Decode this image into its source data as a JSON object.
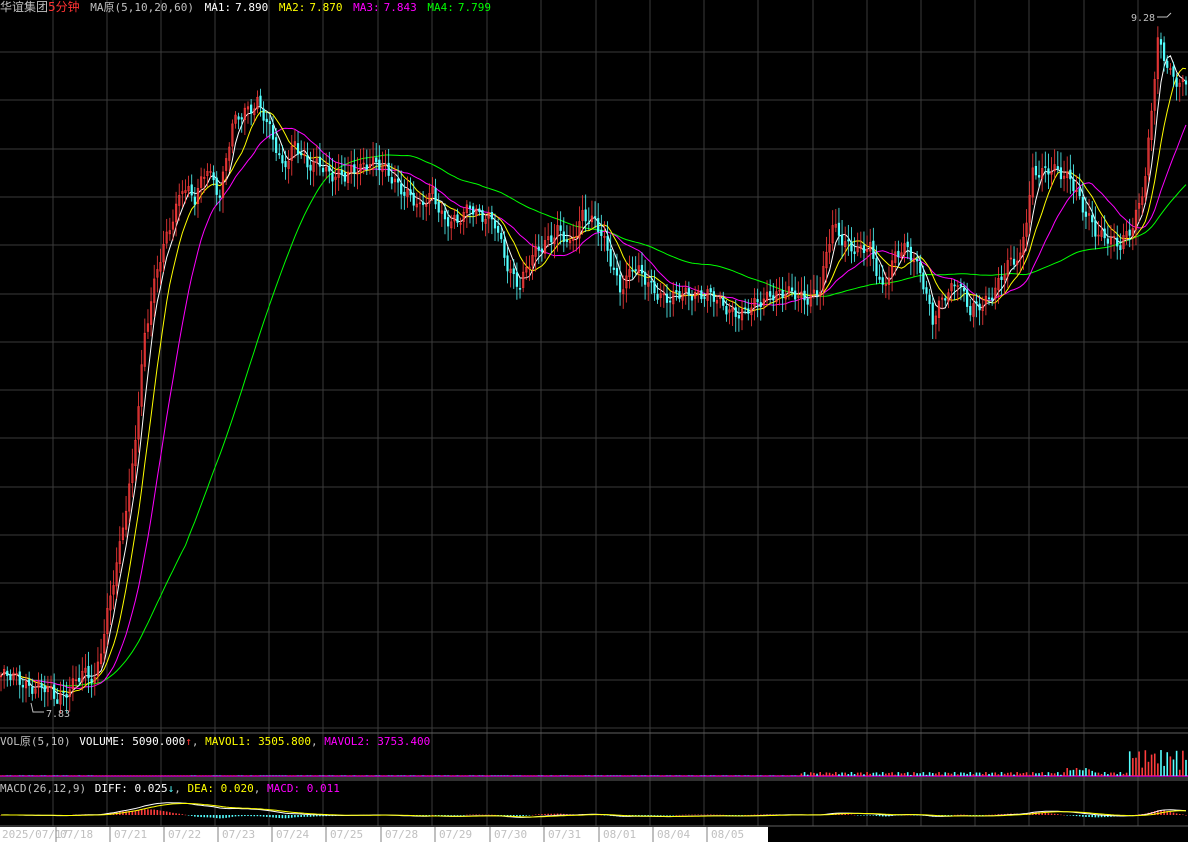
{
  "colors": {
    "background": "#000000",
    "grid": "#3a3a3a",
    "up": "#ff3c3c",
    "down": "#54ffff",
    "ma1": "#ffffff",
    "ma2": "#ffff00",
    "ma3": "#ff00ff",
    "ma4": "#00ff00",
    "stock_name": "#c0c0c0",
    "period": "#ff3333"
  },
  "price_header": {
    "stock": "华谊集团",
    "period": "5分钟",
    "indicator": "MA原(5,10,20,60)",
    "ma1_label": "MA1:",
    "ma1_value": "7.890",
    "ma2_label": "MA2:",
    "ma2_value": "7.870",
    "ma3_label": "MA3:",
    "ma3_value": "7.843",
    "ma4_label": "MA4:",
    "ma4_value": "7.799"
  },
  "volume_header": {
    "indicator": "VOL原(5,10)",
    "volume_label": "VOLUME:",
    "volume_value": "5090.000",
    "arrow": "↑",
    "mavol1_label": "MAVOL1:",
    "mavol1_value": "3505.800",
    "mavol2_label": "MAVOL2:",
    "mavol2_value": "3753.400"
  },
  "macd_header": {
    "indicator": "MACD(26,12,9)",
    "diff_label": "DIFF:",
    "diff_value": "0.025",
    "arrow": "↓",
    "dea_label": "DEA:",
    "dea_value": "0.020",
    "macd_label": "MACD:",
    "macd_value": "0.011"
  },
  "annotations": {
    "high_label": "9.28",
    "low_label": "7.83"
  },
  "chart_data": {
    "type": "candlestick",
    "interval": "5分钟",
    "high": 9.28,
    "low": 7.83,
    "ylim": [
      7.8,
      9.3
    ],
    "dates": [
      "2025/07/17",
      "07/18",
      "07/21",
      "07/22",
      "07/23",
      "07/24",
      "07/25",
      "07/28",
      "07/29",
      "07/30",
      "07/31",
      "08/01",
      "08/04",
      "08/05"
    ],
    "close_path": [
      [
        0,
        7.88
      ],
      [
        6,
        7.87
      ],
      [
        10,
        7.86
      ],
      [
        14,
        7.85
      ],
      [
        18,
        7.83
      ],
      [
        22,
        7.86
      ],
      [
        26,
        7.88
      ],
      [
        30,
        7.87
      ],
      [
        34,
        8.02
      ],
      [
        38,
        8.15
      ],
      [
        42,
        8.33
      ],
      [
        46,
        8.62
      ],
      [
        50,
        8.75
      ],
      [
        54,
        8.85
      ],
      [
        58,
        8.94
      ],
      [
        62,
        8.9
      ],
      [
        66,
        8.98
      ],
      [
        70,
        8.92
      ],
      [
        74,
        9.06
      ],
      [
        78,
        9.1
      ],
      [
        82,
        9.12
      ],
      [
        86,
        9.05
      ],
      [
        90,
        8.98
      ],
      [
        94,
        9.03
      ],
      [
        98,
        8.97
      ],
      [
        102,
        8.99
      ],
      [
        106,
        8.96
      ],
      [
        110,
        8.95
      ],
      [
        114,
        8.98
      ],
      [
        118,
        8.99
      ],
      [
        122,
        8.97
      ],
      [
        126,
        8.95
      ],
      [
        130,
        8.92
      ],
      [
        134,
        8.88
      ],
      [
        138,
        8.93
      ],
      [
        142,
        8.86
      ],
      [
        146,
        8.85
      ],
      [
        150,
        8.9
      ],
      [
        154,
        8.87
      ],
      [
        158,
        8.85
      ],
      [
        162,
        8.77
      ],
      [
        166,
        8.72
      ],
      [
        170,
        8.78
      ],
      [
        174,
        8.82
      ],
      [
        178,
        8.84
      ],
      [
        182,
        8.8
      ],
      [
        186,
        8.88
      ],
      [
        190,
        8.86
      ],
      [
        194,
        8.79
      ],
      [
        198,
        8.72
      ],
      [
        202,
        8.76
      ],
      [
        206,
        8.73
      ],
      [
        210,
        8.71
      ],
      [
        214,
        8.69
      ],
      [
        218,
        8.7
      ],
      [
        222,
        8.71
      ],
      [
        226,
        8.7
      ],
      [
        230,
        8.68
      ],
      [
        234,
        8.67
      ],
      [
        238,
        8.66
      ],
      [
        242,
        8.68
      ],
      [
        246,
        8.71
      ],
      [
        250,
        8.7
      ],
      [
        254,
        8.7
      ],
      [
        258,
        8.7
      ],
      [
        262,
        8.71
      ],
      [
        266,
        8.85
      ],
      [
        270,
        8.82
      ],
      [
        274,
        8.79
      ],
      [
        278,
        8.8
      ],
      [
        282,
        8.72
      ],
      [
        286,
        8.78
      ],
      [
        290,
        8.8
      ],
      [
        294,
        8.76
      ],
      [
        298,
        8.64
      ],
      [
        302,
        8.7
      ],
      [
        306,
        8.74
      ],
      [
        310,
        8.66
      ],
      [
        314,
        8.68
      ],
      [
        318,
        8.72
      ],
      [
        322,
        8.76
      ],
      [
        326,
        8.78
      ],
      [
        330,
        8.97
      ],
      [
        334,
        8.96
      ],
      [
        338,
        8.97
      ],
      [
        342,
        8.96
      ],
      [
        346,
        8.88
      ],
      [
        350,
        8.84
      ],
      [
        354,
        8.83
      ],
      [
        358,
        8.8
      ],
      [
        362,
        8.85
      ],
      [
        366,
        8.96
      ],
      [
        370,
        9.24
      ],
      [
        374,
        9.18
      ],
      [
        378,
        9.16
      ]
    ],
    "n_bars": 380
  }
}
